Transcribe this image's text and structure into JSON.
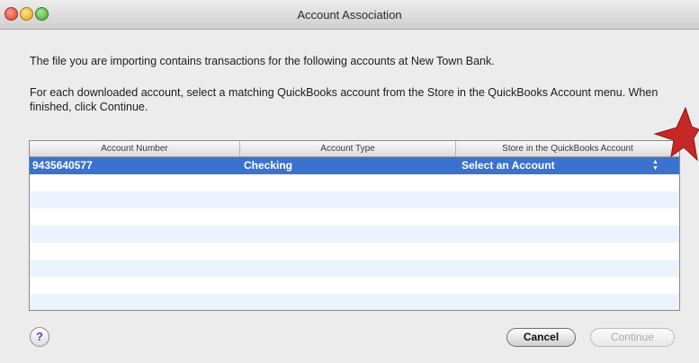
{
  "window": {
    "title": "Account Association"
  },
  "message": {
    "intro": "The file you are importing contains transactions for the following accounts at New Town Bank.",
    "instruction": "For each downloaded account, select a matching QuickBooks account from the Store in the QuickBooks Account menu. When finished, click Continue."
  },
  "table": {
    "headers": [
      "Account Number",
      "Account Type",
      "Store in the QuickBooks Account"
    ],
    "rows": [
      {
        "account_number": "9435640577",
        "account_type": "Checking",
        "quickbooks_account": "Select an Account",
        "selected": true
      }
    ]
  },
  "footer": {
    "help_label": "?",
    "cancel_label": "Cancel",
    "continue_label": "Continue"
  },
  "colors": {
    "selection": "#3b72cf",
    "stripe": "#edf3fe",
    "star": "#c62828"
  },
  "icons": {
    "close": "close-button-icon",
    "minimize": "minimize-button-icon",
    "zoom": "zoom-button-icon",
    "popup": "popup-stepper-icon",
    "annotation": "red-star-icon"
  }
}
